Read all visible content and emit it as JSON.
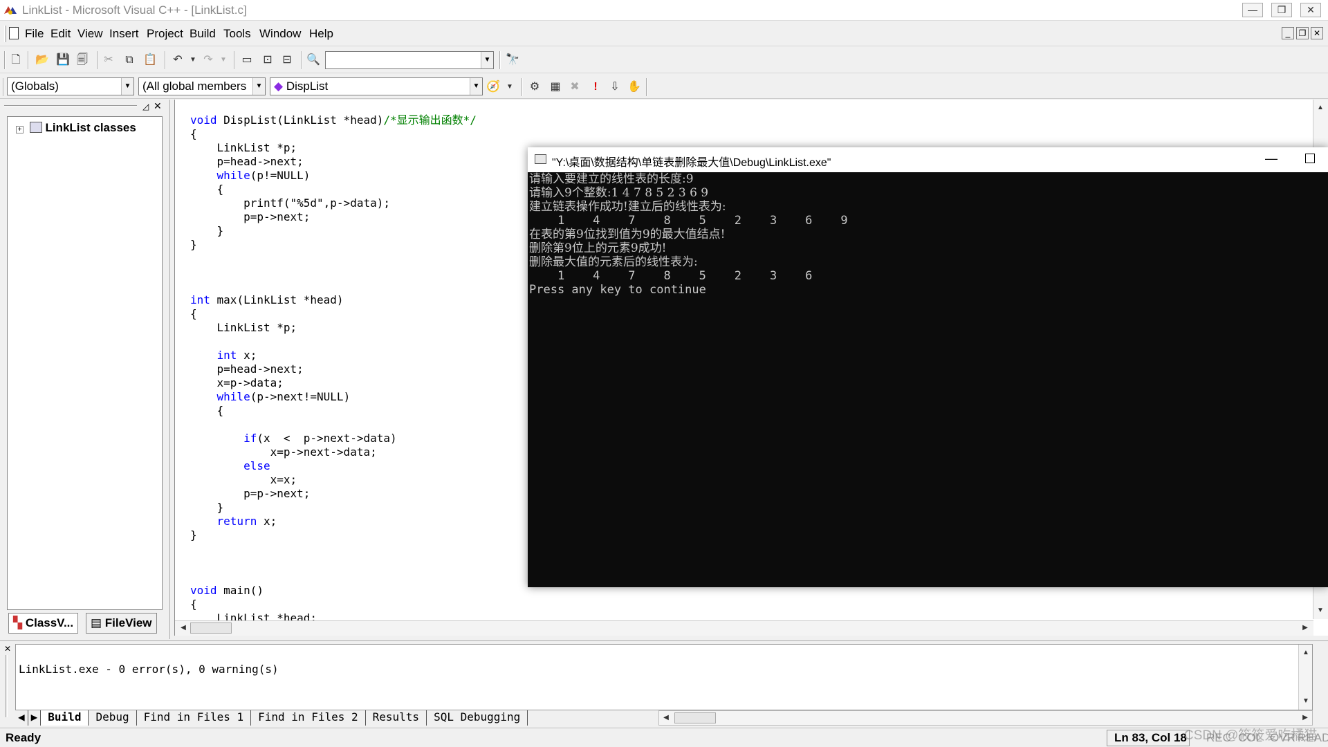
{
  "window": {
    "title": "LinkList - Microsoft Visual C++ - [LinkList.c]"
  },
  "menu": [
    "File",
    "Edit",
    "View",
    "Insert",
    "Project",
    "Build",
    "Tools",
    "Window",
    "Help"
  ],
  "toolbar": {
    "find_value": "",
    "globals_combo": "(Globals)",
    "members_combo": "(All global members",
    "function_combo": "DispList"
  },
  "workspace": {
    "tree_root": "LinkList classes",
    "tab_classview": "ClassV...",
    "tab_fileview": "FileView"
  },
  "editor": {
    "lines": [
      "void DispList(LinkList *head)/*显示输出函数*/",
      "{",
      "    LinkList *p;",
      "    p=head->next;",
      "    while(p!=NULL)",
      "    {",
      "        printf(\"%5d\",p->data);",
      "        p=p->next;",
      "    }",
      "}",
      "",
      "",
      "",
      "int max(LinkList *head)",
      "{",
      "    LinkList *p;",
      "",
      "    int x;",
      "    p=head->next;",
      "    x=p->data;",
      "    while(p->next!=NULL)",
      "    {",
      "",
      "        if(x  <  p->next->data)",
      "            x=p->next->data;",
      "        else",
      "            x=x;",
      "        p=p->next;",
      "    }",
      "    return x;",
      "}",
      "",
      "",
      "",
      "void main()",
      "{",
      "    LinkList *head;"
    ]
  },
  "console": {
    "title": "\"Y:\\桌面\\数据结构\\单链表删除最大值\\Debug\\LinkList.exe\"",
    "lines": [
      "请输入要建立的线性表的长度:9",
      "请输入9个整数:1 4 7 8 5 2 3 6 9",
      "建立链表操作成功!建立后的线性表为:",
      "    1    4    7    8    5    2    3    6    9",
      "在表的第9位找到值为9的最大值结点!",
      "删除第9位上的元素9成功!",
      "删除最大值的元素后的线性表为:",
      "    1    4    7    8    5    2    3    6",
      "Press any key to continue"
    ]
  },
  "output": {
    "message": "LinkList.exe - 0 error(s), 0 warning(s)",
    "tabs": [
      "Build",
      "Debug",
      "Find in Files 1",
      "Find in Files 2",
      "Results",
      "SQL Debugging"
    ]
  },
  "status": {
    "ready": "Ready",
    "position": "Ln 83, Col 18",
    "indicators": [
      "REC",
      "COL",
      "OVR",
      "READ"
    ]
  },
  "watermark": "CSDN @筱筱爱吃橘猫"
}
